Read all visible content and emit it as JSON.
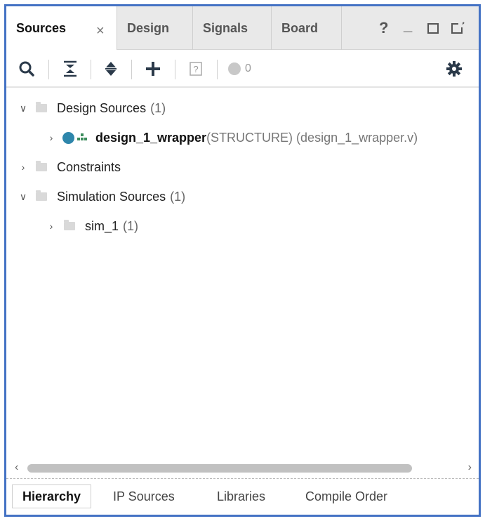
{
  "tabs": [
    {
      "label": "Sources",
      "active": true
    },
    {
      "label": "Design"
    },
    {
      "label": "Signals"
    },
    {
      "label": "Board"
    }
  ],
  "window_controls": {
    "help": "?",
    "minimize": "_"
  },
  "toolbar": {
    "icons": [
      "search-icon",
      "collapse-all-icon",
      "expand-all-icon",
      "add-icon",
      "unknown-help-icon",
      "status-circle-icon",
      "gear-icon"
    ],
    "status_count": "0"
  },
  "tree": {
    "design_sources": {
      "label": "Design Sources",
      "count": "(1)"
    },
    "wrapper": {
      "name": "design_1_wrapper",
      "detail": "(STRUCTURE) (design_1_wrapper.v)"
    },
    "constraints": {
      "label": "Constraints"
    },
    "simulation_sources": {
      "label": "Simulation Sources",
      "count": "(1)"
    },
    "sim_1": {
      "label": "sim_1",
      "count": "(1)"
    }
  },
  "bottom_tabs": [
    {
      "label": "Hierarchy",
      "active": true
    },
    {
      "label": "IP Sources"
    },
    {
      "label": "Libraries"
    },
    {
      "label": "Compile Order"
    }
  ],
  "colors": {
    "frame_border": "#4472c4",
    "accent_teal": "#2e86ab",
    "icon_dark": "#2b3a4a"
  }
}
